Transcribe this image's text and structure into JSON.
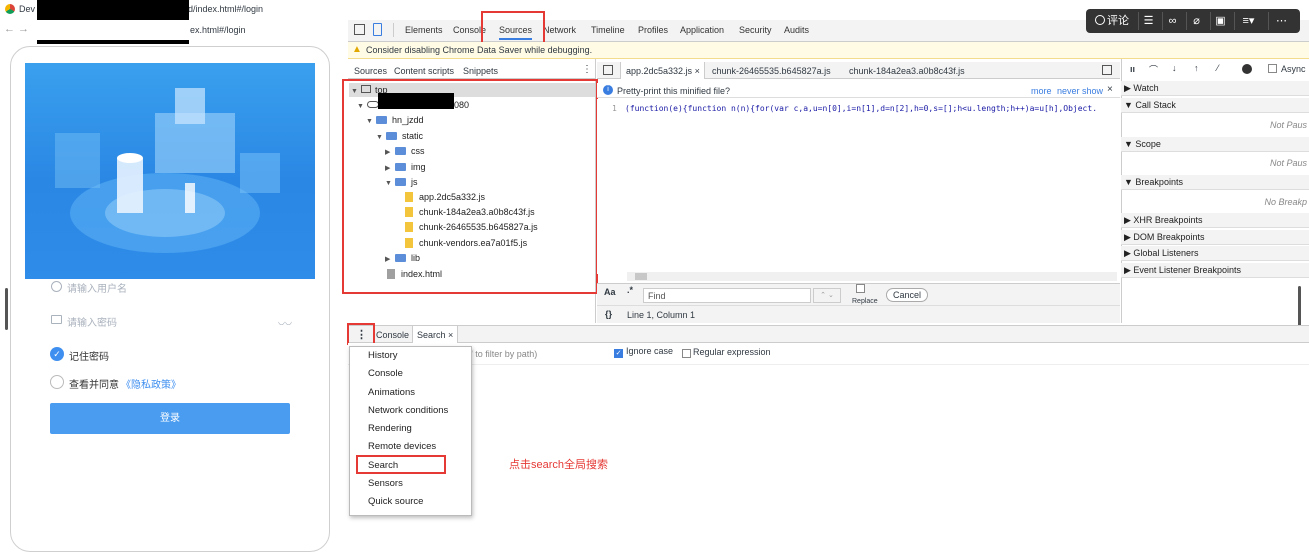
{
  "browser": {
    "tab_title_prefix": "Dev",
    "tab_title_suffix": "d/index.html#/login",
    "url_suffix": "ex.html#/login"
  },
  "phone": {
    "username_placeholder": "请输入用户名",
    "password_placeholder": "请输入密码",
    "remember_label": "记住密码",
    "agree_prefix": "查看并同意",
    "privacy_link": "《隐私政策》",
    "login_button": "登录"
  },
  "devtools": {
    "main_tabs": [
      "Elements",
      "Console",
      "Sources",
      "Network",
      "Timeline",
      "Profiles",
      "Application",
      "Security",
      "Audits"
    ],
    "warning": "Consider disabling Chrome Data Saver while debugging.",
    "nav_tabs": [
      "Sources",
      "Content scripts",
      "Snippets"
    ],
    "tree": {
      "top": "top",
      "host_suffix": "080",
      "folder1": "hn_jzdd",
      "folder2": "static",
      "css": "css",
      "img": "img",
      "js": "js",
      "files": [
        "app.2dc5a332.js",
        "chunk-184a2ea3.a0b8c43f.js",
        "chunk-26465535.b645827a.js",
        "chunk-vendors.ea7a01f5.js"
      ],
      "lib": "lib",
      "index": "index.html"
    },
    "editor_tabs": [
      "app.2dc5a332.js",
      "chunk-26465535.b645827a.js",
      "chunk-184a2ea3.a0b8c43f.js"
    ],
    "prettyprint": "Pretty-print this minified file?",
    "prettyprint_more": "more",
    "prettyprint_never": "never show",
    "code_line_no": "1",
    "code_line": "(function(e){function n(n){for(var c,a,u=n[0],i=n[1],d=n[2],h=0,s=[];h<u.length;h++)a=u[h],Object.",
    "find_aa": "Aa",
    "find_regex": ".*",
    "find_placeholder": "Find",
    "find_replace": "Replace",
    "find_cancel": "Cancel",
    "status": "Line 1, Column 1",
    "status_icon": "{}",
    "async_label": "Async",
    "debug_sections": {
      "watch": "Watch",
      "callstack": "Call Stack",
      "callstack_empty": "Not Paus",
      "scope": "Scope",
      "scope_empty": "Not Paus",
      "breakpoints": "Breakpoints",
      "breakpoints_empty": "No Breakp",
      "xhr": "XHR Breakpoints",
      "dom": "DOM Breakpoints",
      "global": "Global Listeners",
      "event": "Event Listener Breakpoints"
    },
    "drawer_tabs": [
      "Console",
      "Search"
    ],
    "search_placeholder_tail": "le:\" to filter by path)",
    "ignore_case": "Ignore case",
    "regex_label": "Regular expression",
    "menu_items": [
      "History",
      "Console",
      "Animations",
      "Network conditions",
      "Rendering",
      "Remote devices",
      "Search",
      "Sensors",
      "Quick source"
    ]
  },
  "annotation": "点击search全局搜索",
  "top_right": {
    "comment_label": "评论"
  },
  "colors": {
    "annotation_red": "#e53935",
    "hero_blue": "#2a87e4",
    "login_blue": "#4a9cf0"
  }
}
